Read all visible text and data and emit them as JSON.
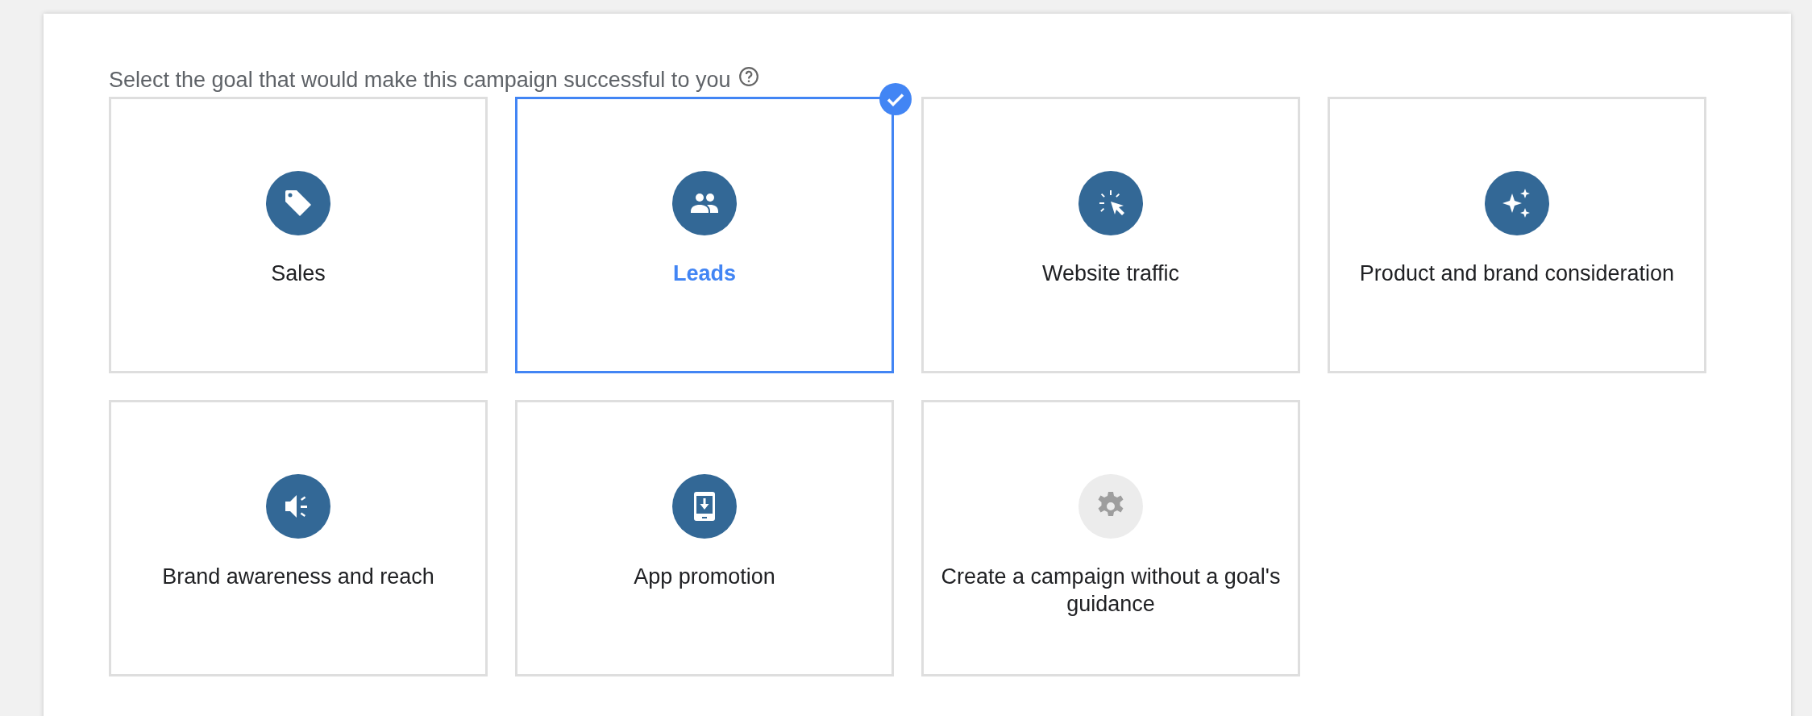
{
  "prompt": "Select the goal that would make this campaign successful to you",
  "goals": [
    {
      "label": "Sales",
      "kind": "tag",
      "selected": false
    },
    {
      "label": "Leads",
      "kind": "people",
      "selected": true
    },
    {
      "label": "Website traffic",
      "kind": "cursor",
      "selected": false
    },
    {
      "label": "Product and brand consideration",
      "kind": "sparkle",
      "selected": false
    },
    {
      "label": "Brand awareness and reach",
      "kind": "speaker",
      "selected": false
    },
    {
      "label": "App promotion",
      "kind": "phone",
      "selected": false
    },
    {
      "label": "Create a campaign without a goal's guidance",
      "kind": "gear",
      "selected": false
    }
  ]
}
